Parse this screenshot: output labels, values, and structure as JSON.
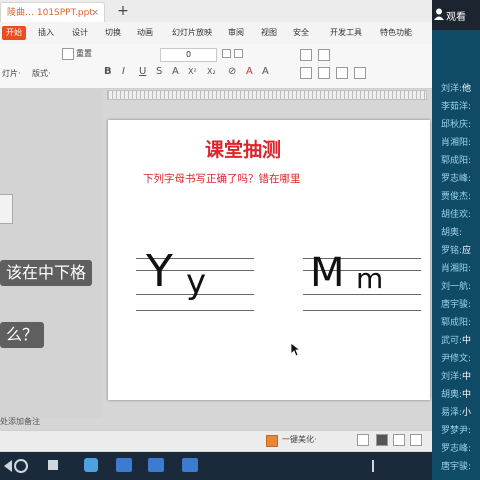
{
  "titlebar": {
    "doc_tab_label": "陵曲… 101SPPT.ppt",
    "new_tab_symbol": "+"
  },
  "ribbon": {
    "tabs": [
      "开始",
      "插入",
      "设计",
      "切换",
      "动画",
      "幻灯片放映",
      "审阅",
      "视图",
      "安全",
      "开发工具",
      "特色功能"
    ],
    "active_tab": "开始"
  },
  "toolbar": {
    "reset_label": "重置",
    "font_size_value": "0",
    "new_slide_label": "灯片·",
    "layout_label": "版式·",
    "format_buttons": [
      "B",
      "I",
      "U",
      "S",
      "A",
      "X²",
      "X₂",
      "⊘",
      "A",
      "A"
    ],
    "format_colors": {
      "bold": "#555555",
      "font_color": "#333333",
      "highlight": "#c0392b"
    }
  },
  "left_panel": {
    "subtitle_1": "该在中下格",
    "subtitle_2": "么？",
    "notes_hint": "处添加备注"
  },
  "slide": {
    "title": "课堂抽测",
    "question": "下列字母书写正确了吗？错在哪里",
    "letters_left_upper": "Y",
    "letters_left_lower": "y",
    "letters_right_upper": "M",
    "letters_right_lower": "m",
    "title_color": "#d9262c"
  },
  "statusbar": {
    "beautify_label": "一键美化·"
  },
  "chat": {
    "viewers_label": "观看",
    "messages": [
      {
        "name": "刘洋:",
        "text": "他"
      },
      {
        "name": "李茹洋:",
        "text": ""
      },
      {
        "name": "邱秋庆:",
        "text": ""
      },
      {
        "name": "肖湘阳:",
        "text": ""
      },
      {
        "name": "郓成阳:",
        "text": ""
      },
      {
        "name": "罗志峰:",
        "text": ""
      },
      {
        "name": "贾俊杰:",
        "text": ""
      },
      {
        "name": "胡佳欢:",
        "text": ""
      },
      {
        "name": "胡奥:",
        "text": ""
      },
      {
        "name": "罗铭:",
        "text": "应"
      },
      {
        "name": "肖湘阳:",
        "text": ""
      },
      {
        "name": "刘一航:",
        "text": ""
      },
      {
        "name": "唐宇骏:",
        "text": ""
      },
      {
        "name": "郓成阳:",
        "text": ""
      },
      {
        "name": "武可:",
        "text": "中"
      },
      {
        "name": "尹修文:",
        "text": ""
      },
      {
        "name": "刘洋:",
        "text": "中"
      },
      {
        "name": "胡奥:",
        "text": "中"
      },
      {
        "name": "易泽:",
        "text": "小"
      },
      {
        "name": "罗梦尹:",
        "text": ""
      },
      {
        "name": "罗志峰:",
        "text": ""
      },
      {
        "name": "唐宇骏:",
        "text": ""
      }
    ]
  }
}
